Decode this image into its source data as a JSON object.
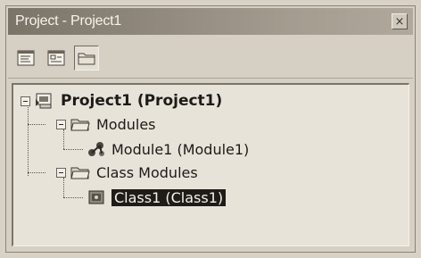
{
  "window": {
    "title": "Project - Project1",
    "close_glyph": "×"
  },
  "toolbar": {
    "buttons": [
      {
        "name": "view-code-button",
        "icon": "view-code-icon",
        "pressed": false
      },
      {
        "name": "view-object-button",
        "icon": "view-object-icon",
        "pressed": false
      },
      {
        "name": "toggle-folders-button",
        "icon": "folder-icon",
        "pressed": true
      }
    ]
  },
  "tree": {
    "project": {
      "label": "Project1 (Project1)",
      "expanded": true,
      "icon": "project-icon"
    },
    "modules_folder": {
      "label": "Modules",
      "expanded": true,
      "icon": "folder-icon"
    },
    "module1": {
      "label": "Module1 (Module1)",
      "icon": "module-icon"
    },
    "class_modules_folder": {
      "label": "Class Modules",
      "expanded": true,
      "icon": "folder-icon"
    },
    "class1": {
      "label": "Class1 (Class1)",
      "icon": "class-icon",
      "selected": true
    }
  },
  "colors": {
    "selection_bg": "#1f1c18",
    "selection_fg": "#f5f2ec",
    "titlebar": "#8c8579"
  }
}
